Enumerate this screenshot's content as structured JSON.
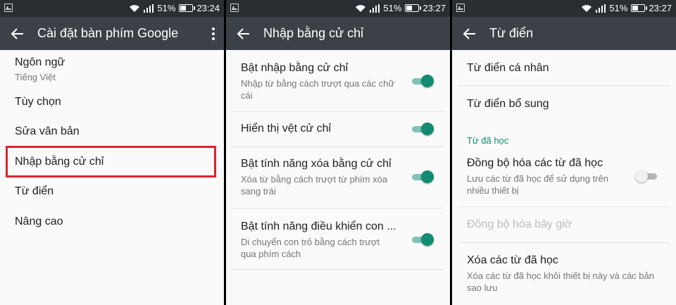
{
  "status_bar": {
    "panel1": {
      "battery": "51%",
      "time": "23:24"
    },
    "panel2": {
      "battery": "51%",
      "time": "23:27"
    },
    "panel3": {
      "battery": "51%",
      "time": "23:27"
    }
  },
  "colors": {
    "accent": "#138a72",
    "appbar": "#3b4147",
    "highlight": "#d7262f"
  },
  "panel1": {
    "title": "Cài đặt bàn phím Google",
    "items": [
      {
        "title": "Ngôn ngữ",
        "summary": "Tiếng Việt"
      },
      {
        "title": "Tùy chọn"
      },
      {
        "title": "Sửa văn bản"
      },
      {
        "title": "Nhập bằng cử chỉ"
      },
      {
        "title": "Từ điển"
      },
      {
        "title": "Nâng cao"
      }
    ]
  },
  "panel2": {
    "title": "Nhập bằng cử chỉ",
    "items": [
      {
        "title": "Bật nhập bằng cử chỉ",
        "summary": "Nhập từ bằng cách trượt qua các chữ cái",
        "enabled": true
      },
      {
        "title": "Hiển thị vệt cử chỉ",
        "enabled": true
      },
      {
        "title": "Bật tính năng xóa bằng cử chỉ",
        "summary": "Xóa từ bằng cách trượt từ phím xóa sang trái",
        "enabled": true
      },
      {
        "title": "Bật tính năng điều khiển con ...",
        "summary": "Di chuyển con trỏ bằng cách trượt qua phím cách",
        "enabled": true
      }
    ]
  },
  "panel3": {
    "title": "Từ điển",
    "items": [
      {
        "title": "Từ điển cá nhân"
      },
      {
        "title": "Từ điển bổ sung"
      }
    ],
    "section_header": "Từ đã học",
    "learned": [
      {
        "title": "Đồng bộ hóa các từ đã học",
        "summary": "Lưu các từ đã học để sử dụng trên nhiều thiết bị",
        "enabled": false
      },
      {
        "title": "Đồng bộ hóa bây giờ",
        "disabled": true
      },
      {
        "title": "Xóa các từ đã học",
        "summary": "Xóa các từ đã học khỏi thiết bị này và các bản sao lưu"
      }
    ]
  }
}
